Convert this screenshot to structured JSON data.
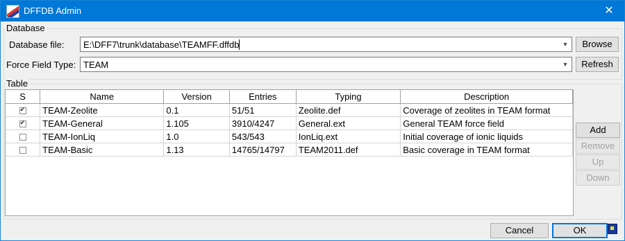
{
  "window": {
    "title": "DFFDB Admin",
    "close_glyph": "✕",
    "app_icon": "dffdb-app-icon"
  },
  "database": {
    "group_label": "Database",
    "file_label": "Database file:",
    "file_value": "E:\\DFF7\\trunk\\database\\TEAMFF.dffdb",
    "browse_label": "Browse",
    "ff_type_label": "Force Field Type:",
    "ff_type_value": "TEAM",
    "refresh_label": "Refresh"
  },
  "table": {
    "group_label": "Table",
    "columns": [
      "S",
      "Name",
      "Version",
      "Entries",
      "Typing",
      "Description"
    ],
    "rows": [
      {
        "selected": true,
        "name": "TEAM-Zeolite",
        "version": "0.1",
        "entries": "51/51",
        "typing": "Zeolite.def",
        "description": "Coverage of zeolites in TEAM format"
      },
      {
        "selected": true,
        "name": "TEAM-General",
        "version": "1.105",
        "entries": "3910/4247",
        "typing": "General.ext",
        "description": "General TEAM force field"
      },
      {
        "selected": false,
        "name": "TEAM-IonLiq",
        "version": "1.0",
        "entries": "543/543",
        "typing": "IonLiq.ext",
        "description": "Initial coverage of ionic liquids"
      },
      {
        "selected": false,
        "name": "TEAM-Basic",
        "version": "1.13",
        "entries": "14765/14797",
        "typing": "TEAM2011.def",
        "description": "Basic coverage in TEAM format"
      }
    ],
    "add_label": "Add",
    "remove_label": "Remove",
    "up_label": "Up",
    "down_label": "Down"
  },
  "footer": {
    "cancel_label": "Cancel",
    "ok_label": "OK",
    "status_icon": "help-icon"
  },
  "colors": {
    "titlebar": "#0078d7",
    "window_bg": "#f0f0f0",
    "disabled_text": "#a0a0a0"
  }
}
